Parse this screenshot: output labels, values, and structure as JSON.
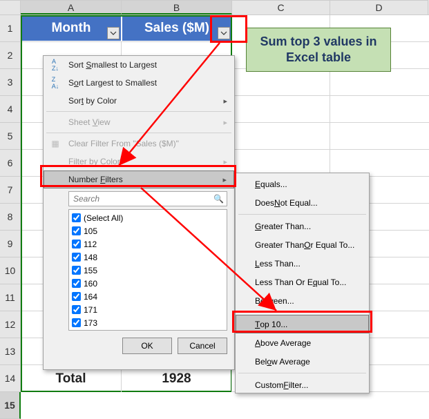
{
  "columns": [
    "A",
    "B",
    "C",
    "D"
  ],
  "rows": [
    "1",
    "2",
    "3",
    "4",
    "5",
    "6",
    "7",
    "8",
    "9",
    "10",
    "11",
    "12",
    "13",
    "14",
    "15"
  ],
  "table": {
    "headers": [
      "Month",
      "Sales ($M)"
    ],
    "total_label": "Total",
    "total_value": "1928"
  },
  "callout": "Sum top 3 values in Excel table",
  "menu": {
    "sort_asc": "Sort Smallest to Largest",
    "sort_desc": "Sort Largest to Smallest",
    "sort_color": "Sort by Color",
    "sheet_view": "Sheet View",
    "clear_filter": "Clear Filter From \"Sales ($M)\"",
    "filter_color": "Filter by Color",
    "number_filters": "Number Filters",
    "search_placeholder": "Search",
    "select_all": "(Select All)",
    "values": [
      "105",
      "112",
      "148",
      "155",
      "160",
      "164",
      "171",
      "173"
    ],
    "ok": "OK",
    "cancel": "Cancel"
  },
  "submenu": {
    "equals": "Equals...",
    "not_equal": "Does Not Equal...",
    "greater": "Greater Than...",
    "greater_eq": "Greater Than Or Equal To...",
    "less": "Less Than...",
    "less_eq": "Less Than Or Equal To...",
    "between": "Between...",
    "top10": "Top 10...",
    "above_avg": "Above Average",
    "below_avg": "Below Average",
    "custom": "Custom Filter..."
  },
  "chart_data": {
    "type": "table",
    "note": "Excel table with filter menu open; visible checklist values are filter options, total row shows sum",
    "filter_values": [
      105,
      112,
      148,
      155,
      160,
      164,
      171,
      173
    ],
    "total": 1928
  }
}
